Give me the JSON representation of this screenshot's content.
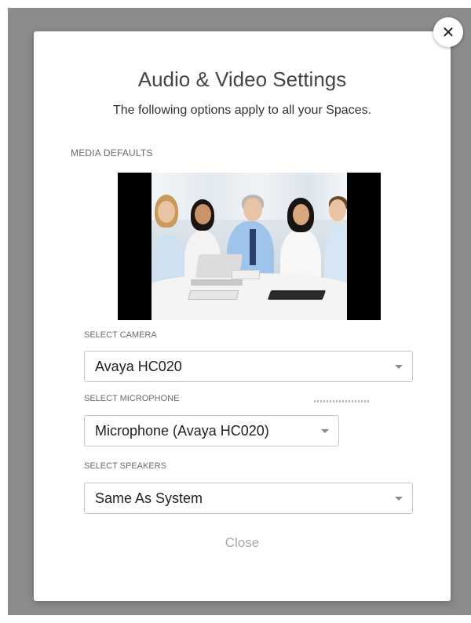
{
  "dialog": {
    "title": "Audio & Video Settings",
    "subtitle": "The following options apply to all your Spaces.",
    "section_label": "MEDIA DEFAULTS",
    "close_label": "Close",
    "close_icon": "close-icon"
  },
  "camera": {
    "label": "SELECT CAMERA",
    "value": "Avaya HC020",
    "icon": "chevron-down-icon"
  },
  "microphone": {
    "label": "SELECT MICROPHONE",
    "value": "Microphone (Avaya HC020)",
    "icon": "chevron-down-icon"
  },
  "speakers": {
    "label": "SELECT SPEAKERS",
    "value": "Same As System",
    "icon": "chevron-down-icon"
  },
  "colors": {
    "backdrop": "#8c8c8c",
    "modal": "#ffffff",
    "text": "#333333",
    "muted": "#a8a8a8"
  }
}
